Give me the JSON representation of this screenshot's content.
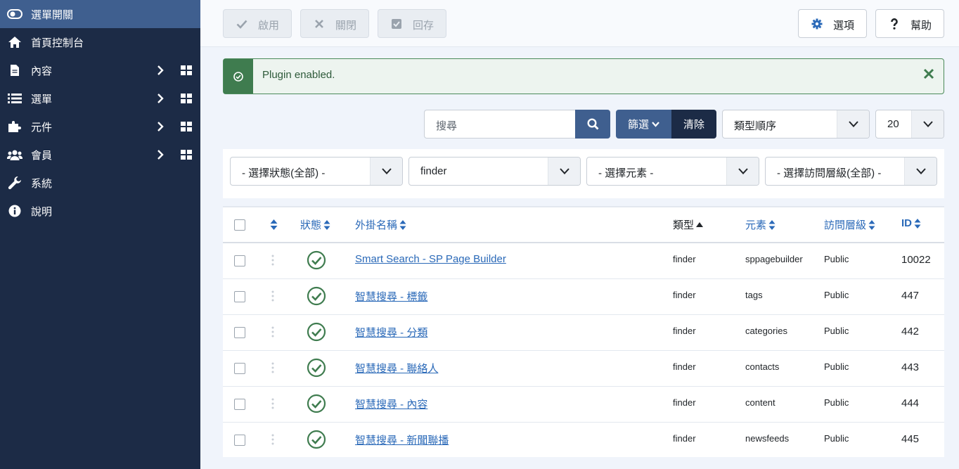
{
  "sidebar": {
    "items": [
      {
        "label": "選單開關",
        "icon": "toggle-icon"
      },
      {
        "label": "首頁控制台",
        "icon": "home-icon"
      },
      {
        "label": "內容",
        "icon": "file-icon"
      },
      {
        "label": "選單",
        "icon": "list-icon"
      },
      {
        "label": "元件",
        "icon": "puzzle-icon"
      },
      {
        "label": "會員",
        "icon": "users-icon"
      },
      {
        "label": "系統",
        "icon": "wrench-icon"
      },
      {
        "label": "說明",
        "icon": "info-icon"
      }
    ]
  },
  "toolbar": {
    "enable_label": "啟用",
    "disable_label": "關閉",
    "checkin_label": "回存",
    "options_label": "選項",
    "help_label": "幫助"
  },
  "alert": {
    "message": "Plugin enabled."
  },
  "search": {
    "placeholder": "搜尋",
    "filter_label": "篩選",
    "clear_label": "清除",
    "ordering": "類型順序",
    "limit": "20"
  },
  "filters": {
    "state": "- 選擇狀態(全部) -",
    "folder": "finder",
    "element": "- 選擇元素 -",
    "access": "- 選擇訪問層級(全部) -"
  },
  "table": {
    "headers": {
      "status": "狀態",
      "name": "外掛名稱",
      "type": "類型",
      "element": "元素",
      "access": "訪問層級",
      "id": "ID"
    },
    "rows": [
      {
        "name": "Smart Search - SP Page Builder",
        "type": "finder",
        "element": "sppagebuilder",
        "access": "Public",
        "id": "10022"
      },
      {
        "name": "智慧搜尋 - 標籤",
        "type": "finder",
        "element": "tags",
        "access": "Public",
        "id": "447"
      },
      {
        "name": "智慧搜尋 - 分類",
        "type": "finder",
        "element": "categories",
        "access": "Public",
        "id": "442"
      },
      {
        "name": "智慧搜尋 - 聯絡人",
        "type": "finder",
        "element": "contacts",
        "access": "Public",
        "id": "443"
      },
      {
        "name": "智慧搜尋 - 內容",
        "type": "finder",
        "element": "content",
        "access": "Public",
        "id": "444"
      },
      {
        "name": "智慧搜尋 - 新聞聯播",
        "type": "finder",
        "element": "newsfeeds",
        "access": "Public",
        "id": "445"
      }
    ]
  },
  "colors": {
    "sidebar_bg": "#1c2b46",
    "accent": "#3f5f8f",
    "link": "#2a69b8",
    "success": "#3f7c4f"
  }
}
